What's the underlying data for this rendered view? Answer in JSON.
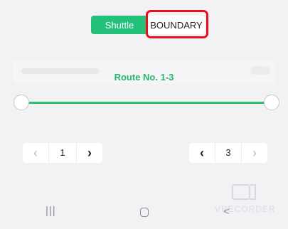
{
  "toggle": {
    "options": [
      "Shuttle",
      "BOUNDARY"
    ],
    "selected": "Shuttle"
  },
  "route": {
    "title": "Route No. 1-3"
  },
  "range": {
    "start": 1,
    "end": 3
  },
  "watermark": {
    "text": "VRECORDER"
  },
  "nav": {
    "recents_glyph": "|||",
    "back_glyph": "<"
  },
  "colors": {
    "accent": "#23c07a",
    "highlight": "#e8101a"
  }
}
